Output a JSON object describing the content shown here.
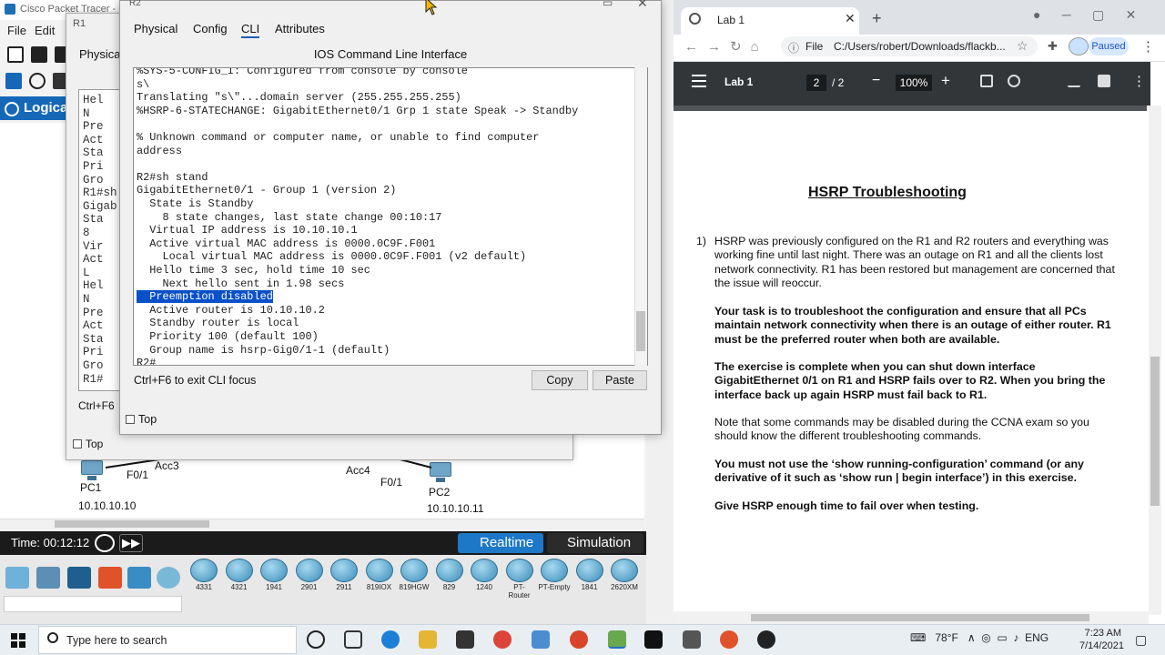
{
  "packet_tracer": {
    "title": "Cisco Packet Tracer - C:\\",
    "r1_window_title": "R1",
    "menu": [
      "File",
      "Edit"
    ],
    "logical_label": "Logical",
    "r1_tab_physical": "Physica",
    "r1_terminal_lines": [
      "Hel",
      "N",
      "Pre",
      "Act",
      "Sta",
      "Pri",
      "Gro",
      "R1#sh",
      "Gigab",
      "Sta",
      "8",
      "Vir",
      "Act",
      "L",
      "Hel",
      "N",
      "Pre",
      "Act",
      "Sta",
      "Pri",
      "Gro",
      "R1#"
    ],
    "r1_ctrl_text": "Ctrl+F6",
    "r1_top_label": "Top",
    "devices": {
      "pc1": {
        "name": "PC1",
        "ip": "10.10.10.10",
        "port": "F0/1",
        "switch": "Acc3"
      },
      "pc2": {
        "name": "PC2",
        "ip": "10.10.10.11",
        "port": "F0/1",
        "switch": "Acc4"
      }
    },
    "time_label": "Time: 00:12:12",
    "realtime_label": "Realtime",
    "simulation_label": "Simulation",
    "router_models": [
      "4331",
      "4321",
      "1941",
      "2901",
      "2911",
      "819IOX",
      "819HGW",
      "829",
      "1240",
      "PT-Router",
      "PT-Empty",
      "1841",
      "2620XM"
    ]
  },
  "r2_window": {
    "title": "R2",
    "tabs": {
      "physical": "Physical",
      "config": "Config",
      "cli": "CLI",
      "attributes": "Attributes"
    },
    "ios_title": "IOS Command Line Interface",
    "terminal_lines": [
      "%SYS-5-CONFIG_I: Configured from console by console",
      "s\\",
      "Translating \"s\\\"...domain server (255.255.255.255)",
      "%HSRP-6-STATECHANGE: GigabitEthernet0/1 Grp 1 state Speak -> Standby",
      "",
      "% Unknown command or computer name, or unable to find computer",
      "address",
      "",
      "R2#sh stand",
      "GigabitEthernet0/1 - Group 1 (version 2)",
      "  State is Standby",
      "    8 state changes, last state change 00:10:17",
      "  Virtual IP address is 10.10.10.1",
      "  Active virtual MAC address is 0000.0C9F.F001",
      "    Local virtual MAC address is 0000.0C9F.F001 (v2 default)",
      "  Hello time 3 sec, hold time 10 sec",
      "    Next hello sent in 1.98 secs",
      "  Preemption disabled",
      "  Active router is 10.10.10.2",
      "  Standby router is local",
      "  Priority 100 (default 100)",
      "  Group name is hsrp-Gig0/1-1 (default)",
      "R2#"
    ],
    "highlighted_line_index": 17,
    "ctrl_text": "Ctrl+F6 to exit CLI focus",
    "copy_label": "Copy",
    "paste_label": "Paste",
    "top_label": "Top"
  },
  "chrome": {
    "tab_title": "Lab 1",
    "new_tab": "+",
    "omnibox_scheme": "File",
    "omnibox_url": "C:/Users/robert/Downloads/flackb...",
    "profile_status": "Paused",
    "pdf": {
      "title": "Lab 1",
      "page_current": "2",
      "page_total": "/ 2",
      "zoom": "100%",
      "heading": "HSRP Troubleshooting",
      "item_number": "1)",
      "paragraphs": [
        {
          "text": "HSRP was previously configured on the R1 and R2 routers and everything was working fine until last night. There was an outage on R1 and all the clients lost network connectivity. R1 has been restored but management are concerned that the issue will reoccur.",
          "bold": false
        },
        {
          "text": "Your task is to troubleshoot the configuration and ensure that all PCs maintain network connectivity when there is an outage of either router. R1 must be the preferred router when both are available.",
          "bold": true
        },
        {
          "text": "The exercise is complete when you can shut down interface GigabitEthernet 0/1 on R1 and HSRP fails over to R2. When you bring the interface back up again HSRP must fail back to R1.",
          "bold": true
        },
        {
          "text": "Note that some commands may be disabled during the CCNA exam so you should know the different troubleshooting commands.",
          "bold": false
        },
        {
          "text": "You must not use the ‘show running-configuration’ command (or any derivative of it such as ‘show run | begin interface’) in this exercise.",
          "bold": true
        },
        {
          "text": "Give HSRP enough time to fail over when testing.",
          "bold": true
        }
      ]
    }
  },
  "taskbar": {
    "search_placeholder": "Type here to search",
    "temperature": "78°F",
    "time": "7:23 AM",
    "date": "7/14/2021"
  },
  "colors": {
    "cli_highlight": "#0a50c8",
    "realtime_blue": "#1d78c8",
    "pdf_toolbar": "#323639"
  }
}
